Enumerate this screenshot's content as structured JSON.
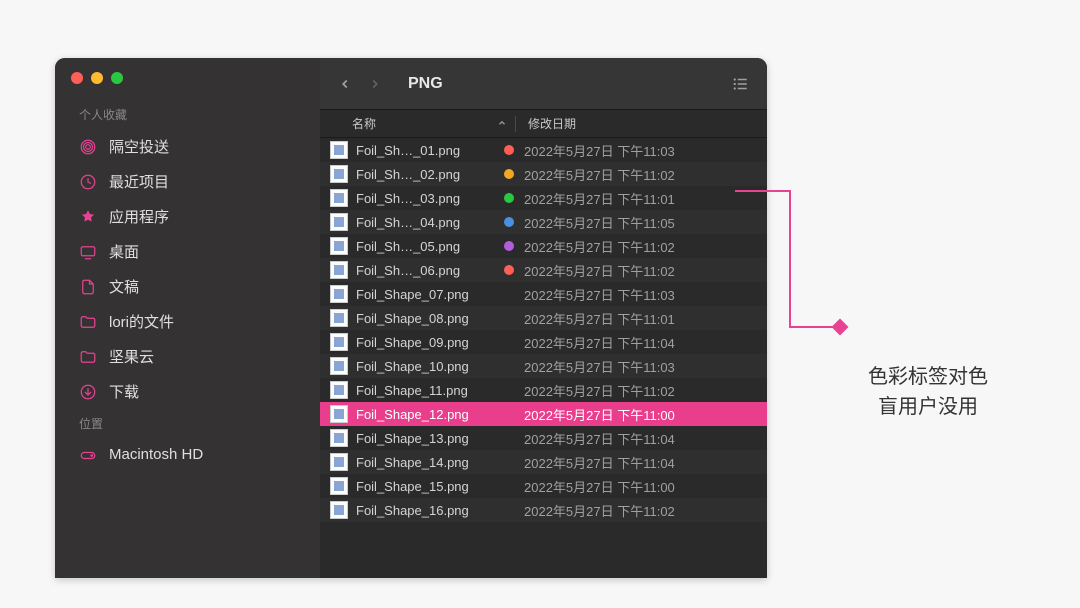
{
  "sidebar": {
    "sections": [
      {
        "title": "个人收藏",
        "items": [
          {
            "icon": "airdrop",
            "label": "隔空投送"
          },
          {
            "icon": "clock",
            "label": "最近项目"
          },
          {
            "icon": "apps",
            "label": "应用程序"
          },
          {
            "icon": "desktop",
            "label": "桌面"
          },
          {
            "icon": "document",
            "label": "文稿"
          },
          {
            "icon": "folder",
            "label": "lori的文件"
          },
          {
            "icon": "folder",
            "label": "坚果云"
          },
          {
            "icon": "download",
            "label": "下载"
          }
        ]
      },
      {
        "title": "位置",
        "items": [
          {
            "icon": "drive",
            "label": "Macintosh HD"
          }
        ]
      }
    ]
  },
  "toolbar": {
    "folder_title": "PNG"
  },
  "columns": {
    "name": "名称",
    "date": "修改日期"
  },
  "tag_colors": {
    "red": "#ff5f57",
    "orange": "#f5a623",
    "green": "#28c840",
    "blue": "#4a90e2",
    "purple": "#b15edc",
    "red2": "#ff5f57"
  },
  "files": [
    {
      "name": "Foil_Sh…_01.png",
      "date": "2022年5月27日 下午11:03",
      "tag": "red",
      "alt": false
    },
    {
      "name": "Foil_Sh…_02.png",
      "date": "2022年5月27日 下午11:02",
      "tag": "orange",
      "alt": true
    },
    {
      "name": "Foil_Sh…_03.png",
      "date": "2022年5月27日 下午11:01",
      "tag": "green",
      "alt": false
    },
    {
      "name": "Foil_Sh…_04.png",
      "date": "2022年5月27日 下午11:05",
      "tag": "blue",
      "alt": true
    },
    {
      "name": "Foil_Sh…_05.png",
      "date": "2022年5月27日 下午11:02",
      "tag": "purple",
      "alt": false
    },
    {
      "name": "Foil_Sh…_06.png",
      "date": "2022年5月27日 下午11:02",
      "tag": "red",
      "alt": true
    },
    {
      "name": "Foil_Shape_07.png",
      "date": "2022年5月27日 下午11:03",
      "tag": null,
      "alt": false
    },
    {
      "name": "Foil_Shape_08.png",
      "date": "2022年5月27日 下午11:01",
      "tag": null,
      "alt": true
    },
    {
      "name": "Foil_Shape_09.png",
      "date": "2022年5月27日 下午11:04",
      "tag": null,
      "alt": false
    },
    {
      "name": "Foil_Shape_10.png",
      "date": "2022年5月27日 下午11:03",
      "tag": null,
      "alt": true
    },
    {
      "name": "Foil_Shape_11.png",
      "date": "2022年5月27日 下午11:02",
      "tag": null,
      "alt": false
    },
    {
      "name": "Foil_Shape_12.png",
      "date": "2022年5月27日 下午11:00",
      "tag": null,
      "alt": true,
      "selected": true
    },
    {
      "name": "Foil_Shape_13.png",
      "date": "2022年5月27日 下午11:04",
      "tag": null,
      "alt": false
    },
    {
      "name": "Foil_Shape_14.png",
      "date": "2022年5月27日 下午11:04",
      "tag": null,
      "alt": true
    },
    {
      "name": "Foil_Shape_15.png",
      "date": "2022年5月27日 下午11:00",
      "tag": null,
      "alt": false
    },
    {
      "name": "Foil_Shape_16.png",
      "date": "2022年5月27日 下午11:02",
      "tag": null,
      "alt": true
    }
  ],
  "annotation": {
    "line1": "色彩标签对色",
    "line2": "盲用户没用"
  }
}
